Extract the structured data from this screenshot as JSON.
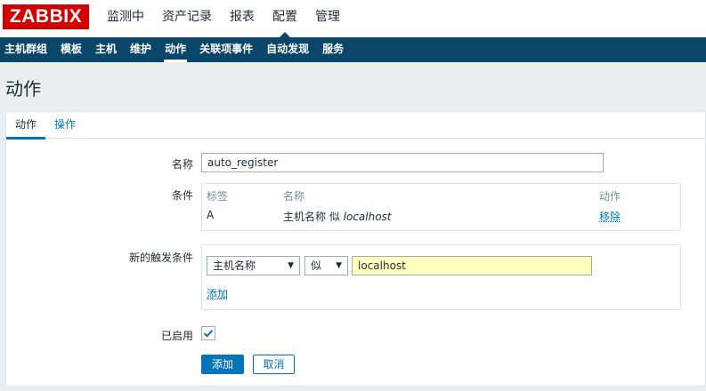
{
  "logo": "ZABBIX",
  "top_menu": [
    {
      "label": "监测中"
    },
    {
      "label": "资产记录"
    },
    {
      "label": "报表"
    },
    {
      "label": "配置",
      "active": true
    },
    {
      "label": "管理"
    }
  ],
  "sub_menu": [
    {
      "label": "主机群组"
    },
    {
      "label": "模板"
    },
    {
      "label": "主机"
    },
    {
      "label": "维护"
    },
    {
      "label": "动作",
      "active": true
    },
    {
      "label": "关联项事件"
    },
    {
      "label": "自动发现"
    },
    {
      "label": "服务"
    }
  ],
  "page_title": "动作",
  "tabs": [
    {
      "label": "动作",
      "active": true
    },
    {
      "label": "操作"
    }
  ],
  "form": {
    "name_label": "名称",
    "name_value": "auto_register",
    "conditions_label": "条件",
    "conditions_table": {
      "headers": {
        "tag": "标签",
        "name": "名称",
        "action": "动作"
      },
      "rows": [
        {
          "tag": "A",
          "name_prefix": "主机名称 似 ",
          "name_value": "localhost",
          "action": "移除"
        }
      ]
    },
    "new_condition_label": "新的触发条件",
    "new_condition": {
      "type_select": "主机名称",
      "operator_select": "似",
      "value": "localhost",
      "add_link": "添加"
    },
    "enabled_label": "已启用",
    "enabled": true,
    "add_button": "添加",
    "cancel_button": "取消"
  },
  "colors": {
    "brand_red": "#d40000",
    "nav_blue": "#0a466a",
    "link_blue": "#0275b8",
    "input_highlight": "#ffffc0"
  }
}
